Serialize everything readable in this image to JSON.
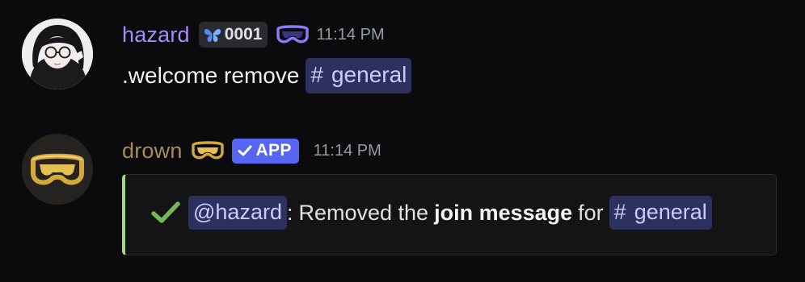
{
  "messages": [
    {
      "author": "hazard",
      "tag": "0001",
      "tag_icon": "butterfly-icon",
      "role_icon": "goggles-icon",
      "role_color": "#8b7cf6",
      "username_color": "#a78bfa",
      "timestamp": "11:14 PM",
      "content": {
        "text": ".welcome remove",
        "channel_mention": "general"
      }
    },
    {
      "author": "drown",
      "role_icon": "goggles-icon",
      "role_color": "#d4a93b",
      "username_color": "#a58d5a",
      "app_badge": "APP",
      "timestamp": "11:14 PM",
      "embed": {
        "accent_color": "#a3d977",
        "check_icon": "checkmark-icon",
        "user_mention": "@hazard",
        "sep": ":",
        "text_before": "Removed the",
        "bold_text": "join message",
        "text_after": "for",
        "channel_mention": "general"
      }
    }
  ]
}
